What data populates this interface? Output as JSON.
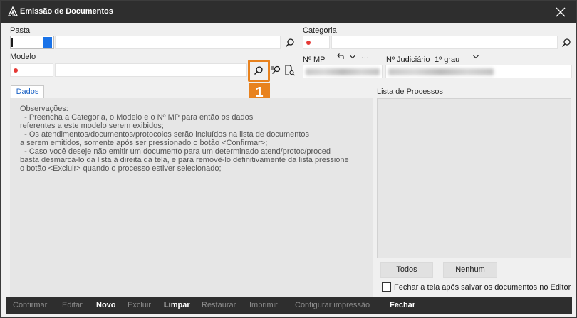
{
  "window": {
    "title": "Emissão de Documentos"
  },
  "fields": {
    "pasta_label": "Pasta",
    "categoria_label": "Categoria",
    "modelo_label": "Modelo",
    "nmp_label": "Nº MP",
    "njudiciario_label": "Nº Judiciário",
    "grau_label": "1º grau",
    "ellipsis": "···"
  },
  "tabs": [
    {
      "label": "Dados"
    }
  ],
  "observations": {
    "lines": [
      "Observações:",
      "  - Preencha a Categoria, o Modelo e o Nº MP para então os dados",
      "referentes a este modelo serem exibidos;",
      "  - Os atendimentos/documentos/protocolos serão incluídos na lista de documentos",
      "a serem emitidos, somente após ser pressionado o botão <Confirmar>;",
      "  - Caso você deseje não emitir um documento para um determinado atend/protoc/proced",
      "basta desmarcá-lo da lista à direita da tela, e para removê-lo definitivamente da lista pressione",
      "o botão <Excluir> quando o processo estiver selecionado;"
    ]
  },
  "processos": {
    "label": "Lista de Processos",
    "todos_label": "Todos",
    "nenhum_label": "Nenhum",
    "fechar_checkbox_label": "Fechar a tela após salvar os documentos no Editor",
    "fechar_checked": false
  },
  "footer": {
    "buttons": [
      {
        "label": "Confirmar",
        "enabled": false
      },
      {
        "label": "Editar",
        "enabled": false
      },
      {
        "label": "Novo",
        "enabled": true
      },
      {
        "label": "Excluir",
        "enabled": false
      },
      {
        "label": "Limpar",
        "enabled": true
      },
      {
        "label": "Restaurar",
        "enabled": false
      },
      {
        "label": "Imprimir",
        "enabled": false
      },
      {
        "label": "Configurar impressão",
        "enabled": false
      },
      {
        "label": "Fechar",
        "enabled": true
      }
    ]
  },
  "annotation": {
    "badge_text": "1"
  },
  "colors": {
    "accent": "#e8821e",
    "required_dot": "#e53935",
    "titlebar": "#2e2e2e",
    "link": "#1a62c5"
  },
  "icons": {
    "search": "search-icon",
    "search_filter": "search-filter-icon",
    "search_document": "search-document-icon",
    "close": "close-icon",
    "undo": "undo-icon",
    "chevron_down": "chevron-down-icon"
  }
}
